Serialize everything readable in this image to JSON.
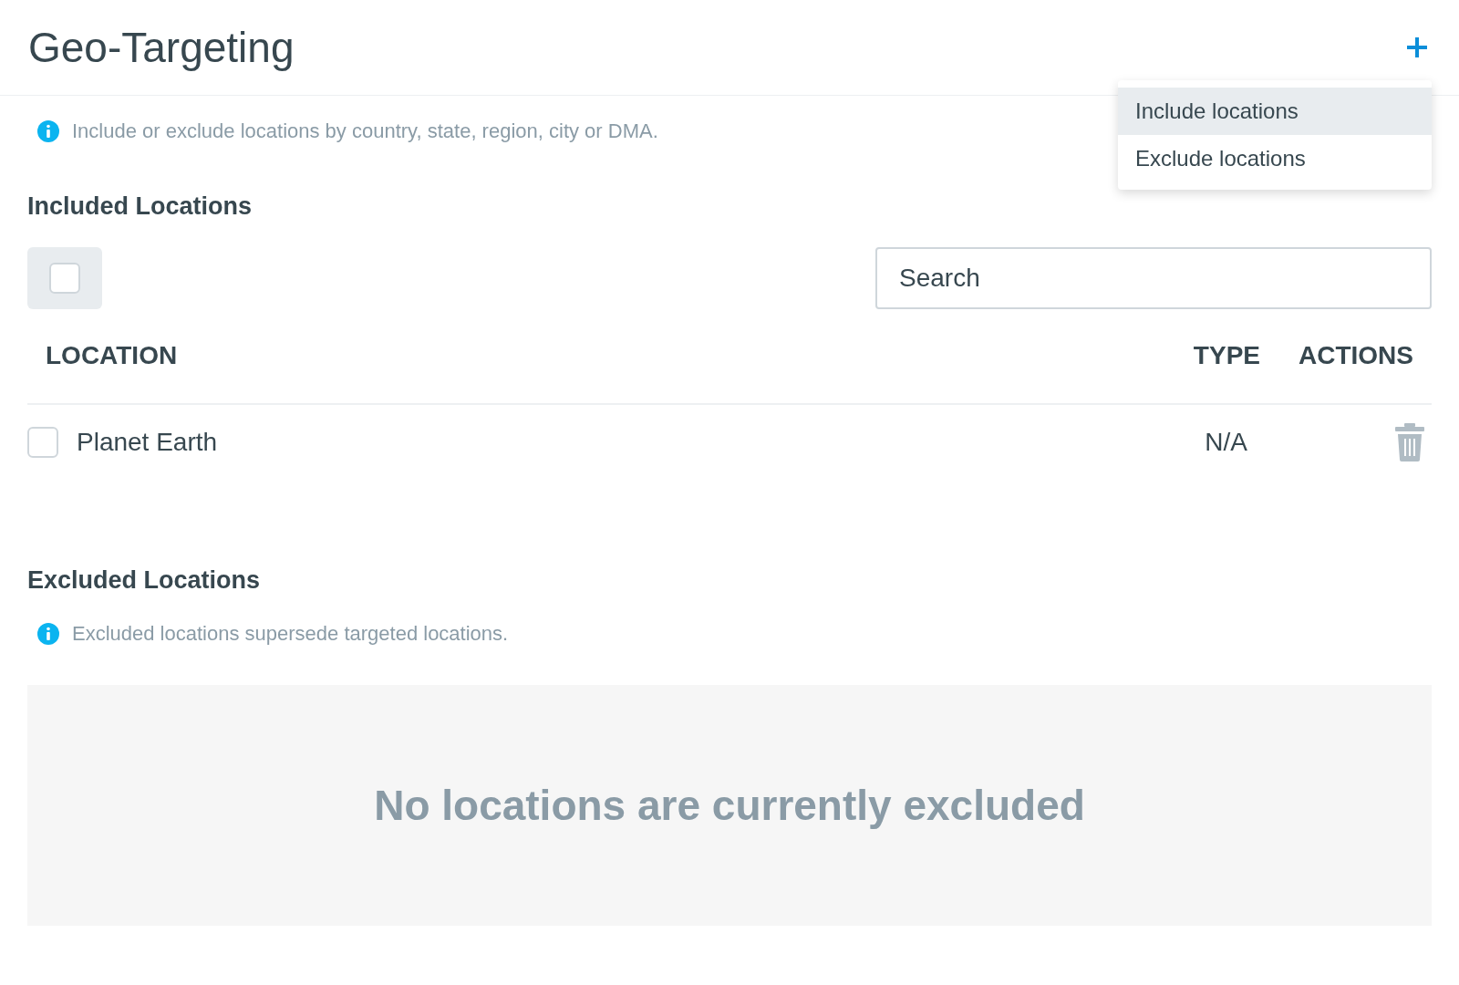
{
  "header": {
    "title": "Geo-Targeting"
  },
  "menu": {
    "items": [
      {
        "label": "Include locations",
        "selected": true
      },
      {
        "label": "Exclude locations",
        "selected": false
      }
    ]
  },
  "included": {
    "info": "Include or exclude locations by country, state, region, city or DMA.",
    "title": "Included Locations",
    "select_all": {
      "checked": false
    },
    "search": {
      "placeholder": "Search"
    },
    "columns": [
      "LOCATION",
      "TYPE",
      "ACTIONS"
    ],
    "rows": [
      {
        "location": "Planet Earth",
        "type": "N/A",
        "checked": false
      }
    ]
  },
  "excluded": {
    "title": "Excluded Locations",
    "info": "Excluded locations supersede targeted locations.",
    "empty": "No locations are currently excluded"
  }
}
